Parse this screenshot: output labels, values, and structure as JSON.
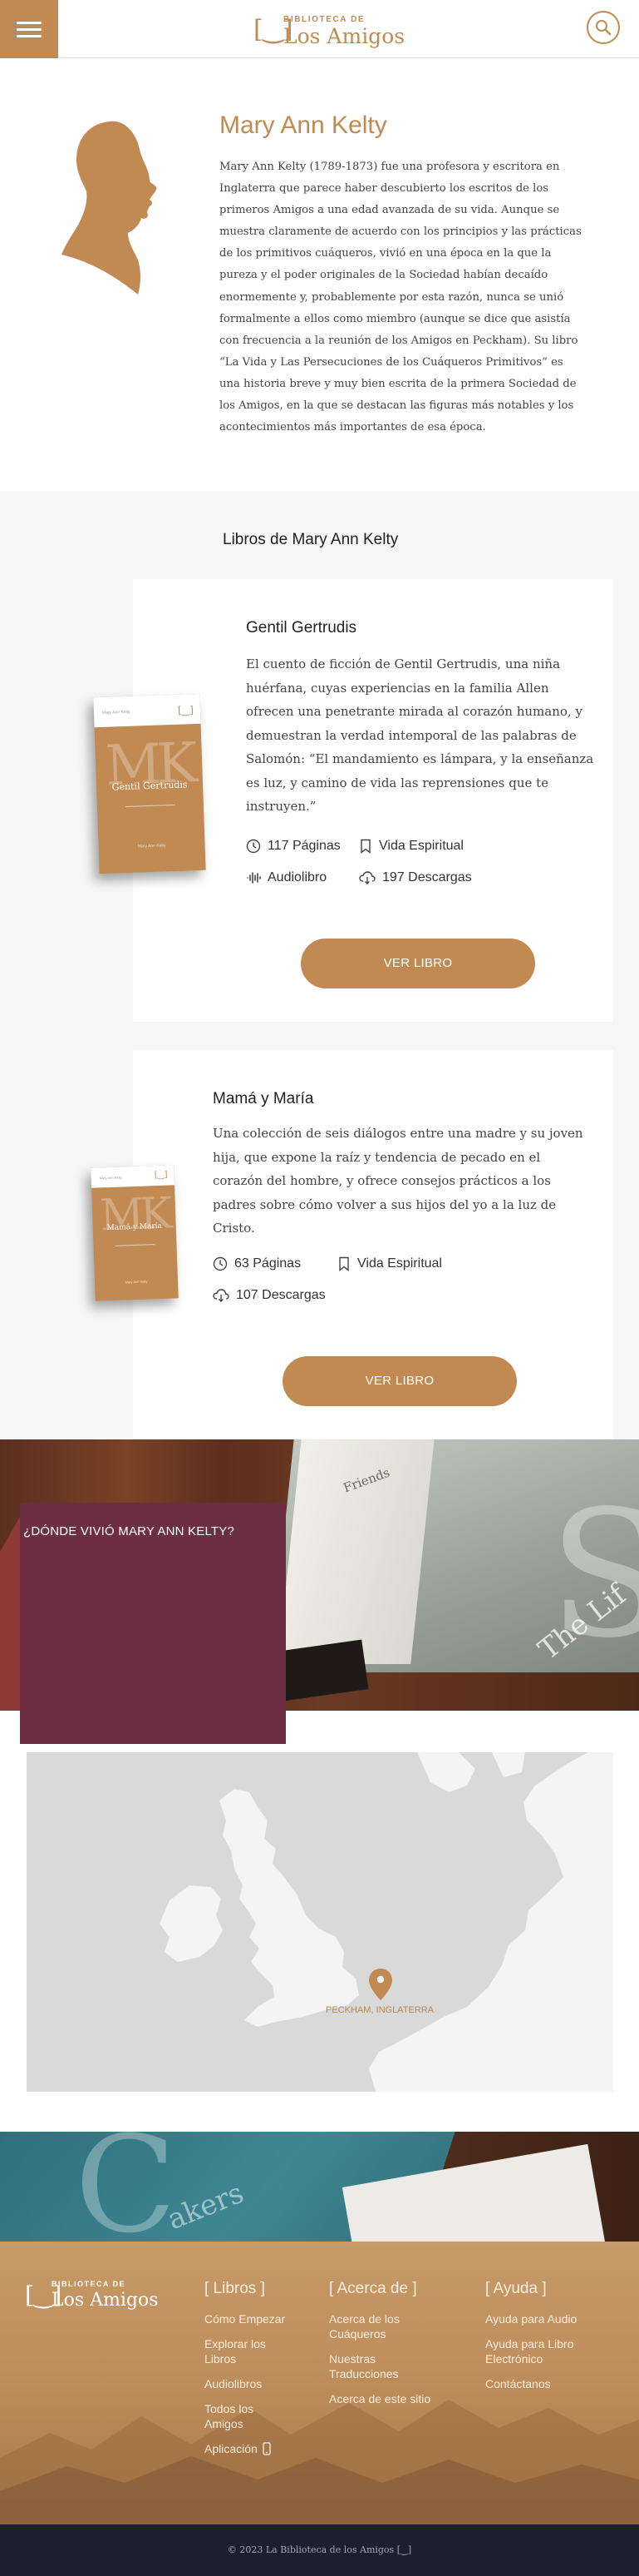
{
  "header": {
    "logo_small": "BIBLIOTECA DE",
    "logo_big": "Los Amigos",
    "logo_bracket": "[‿]",
    "menu_icon": "hamburger-icon",
    "search_icon": "search-icon"
  },
  "author": {
    "name": "Mary Ann Kelty",
    "bio": "Mary Ann Kelty (1789-1873) fue una profesora y escritora en Inglaterra que parece haber descubierto los escritos de los primeros Amigos a una edad avanzada de su vida. Aunque se muestra claramente de acuerdo con los principios y las prácticas de los primitivos cuáqueros, vivió en una época en la que la pureza y el poder originales de la Sociedad habían decaído enormemente y, probablemente por esta razón, nunca se unió formalmente a ellos como miembro (aunque se dice que asistía con frecuencia a la reunión de los Amigos en Peckham). Su libro “La Vida y Las Persecuciones de los Cuáqueros Primitivos” es una historia breve y muy bien escrita de la primera Sociedad de los Amigos, en la que se destacan las figuras más notables y los acontecimientos más importantes de esa época."
  },
  "books_section": {
    "title": "Libros de Mary Ann Kelty",
    "books": [
      {
        "title": "Gentil Gertrudis",
        "description": "El cuento de ficción de Gentil Gertrudis, una niña huérfana, cuyas experiencias en la familia Allen ofrecen una penetrante mirada al corazón humano, y demuestran la verdad intemporal de las palabras de Salomón: “El mandamiento es lámpara, y la enseñanza es luz, y camino de vida las reprensiones que te instruyen.”",
        "pages": "117 Páginas",
        "category": "Vida Espiritual",
        "audio": "Audiolibro",
        "downloads": "197 Descargas",
        "button": "VER LIBRO",
        "cover_title": "Gentil Gertrudis",
        "cover_mono": "MK",
        "cover_author": "Mary Ann Kelty"
      },
      {
        "title": "Mamá y María",
        "description": "Una colección de seis diálogos entre una madre y su joven hija, que expone la raíz y tendencia de pecado en el corazón del hombre, y ofrece consejos prácticos a los padres sobre cómo volver a sus hijos del yo a la luz de Cristo.",
        "pages": "63 Páginas",
        "category": "Vida Espiritual",
        "downloads": "107 Descargas",
        "button": "VER LIBRO",
        "cover_title": "Mamá y María",
        "cover_mono": "MK",
        "cover_author": "Mary Ann Kelty"
      }
    ]
  },
  "where": {
    "title": "¿DÓNDE VIVIÓ MARY ANN KELTY?",
    "map_label": "PECKHAM, INGLATERRA"
  },
  "footer": {
    "logo_small": "BIBLIOTECA DE",
    "logo_big": "Los Amigos",
    "logo_bracket": "[‿]",
    "columns": [
      {
        "heading": "[ Libros ]",
        "links": [
          "Cómo Empezar",
          "Explorar los Libros",
          "Audiolibros",
          "Todos los Amigos",
          "Aplicación"
        ]
      },
      {
        "heading": "[ Acerca de ]",
        "links": [
          "Acerca de los Cuáqueros",
          "Nuestras Traducciones",
          "Acerca de este sitio"
        ]
      },
      {
        "heading": "[ Ayuda ]",
        "links": [
          "Ayuda para Audio",
          "Ayuda para Libro Electrónico",
          "Contáctanos"
        ]
      }
    ],
    "copyright": "© 2023 La Biblioteca de los Amigos [‿]"
  },
  "colors": {
    "accent": "#c08a52",
    "where_box": "#6b2e42",
    "copyright_bg": "#1a2030"
  }
}
